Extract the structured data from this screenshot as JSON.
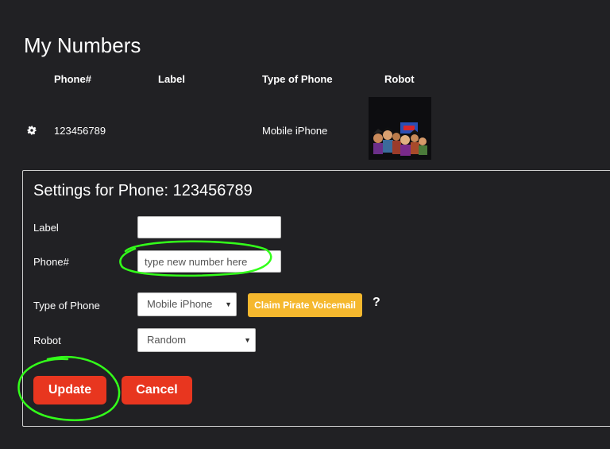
{
  "page": {
    "title": "My Numbers"
  },
  "table": {
    "headers": [
      "Phone#",
      "Label",
      "Type of Phone",
      "Robot"
    ],
    "rows": [
      {
        "phone": "123456789",
        "label": "",
        "type": "Mobile iPhone",
        "robot_image": "pirate-crew-robot"
      }
    ]
  },
  "settings": {
    "title": "Settings for Phone: 123456789",
    "label_field": {
      "label": "Label",
      "value": "",
      "placeholder": ""
    },
    "phone_field": {
      "label": "Phone#",
      "value": "",
      "placeholder": "type new number here"
    },
    "type_field": {
      "label": "Type of Phone",
      "selected": "Mobile iPhone"
    },
    "claim_button": "Claim Pirate Voicemail",
    "help": "?",
    "robot_field": {
      "label": "Robot",
      "selected": "Random"
    },
    "update_button": "Update",
    "cancel_button": "Cancel"
  },
  "icons": {
    "row_settings": "gear-icon",
    "help": "question-icon",
    "dropdown": "chevron-down-icon"
  },
  "colors": {
    "background": "#212124",
    "primary": "#e8361f",
    "accent": "#f5b82e",
    "annotation": "#33ff1a"
  }
}
